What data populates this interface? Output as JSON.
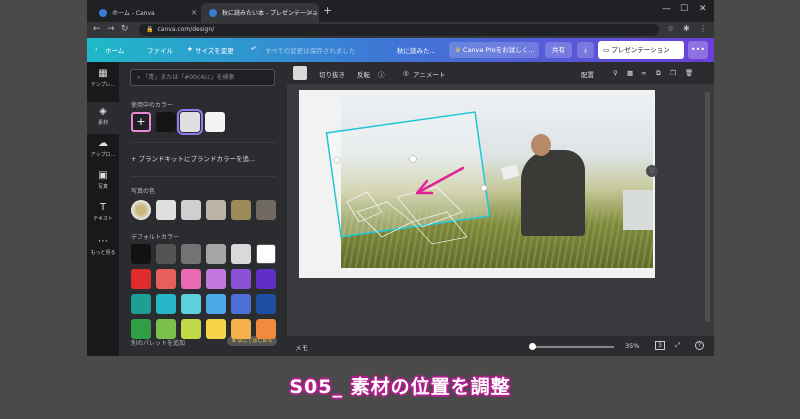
{
  "browser": {
    "tabs": [
      {
        "title": "ホーム - Canva"
      },
      {
        "title": "秋に読みたい本 - プレゼンテーショ"
      }
    ],
    "new_tab": "+",
    "url": "canva.com/design/"
  },
  "header": {
    "home": "ホーム",
    "file": "ファイル",
    "resize": "サイズを変更",
    "saved_status": "すべての変更は保存されました",
    "doc_title": "秋に読みた...",
    "try_pro": "Canva Proをお試しく...",
    "share": "共有",
    "present": "プレゼンテーション",
    "more": "•••"
  },
  "rail": {
    "items": [
      {
        "label": "テンプレ...",
        "icon": "template-icon"
      },
      {
        "label": "素材",
        "icon": "elements-icon"
      },
      {
        "label": "アップロ...",
        "icon": "upload-icon"
      },
      {
        "label": "写真",
        "icon": "photo-icon"
      },
      {
        "label": "テキスト",
        "icon": "text-icon"
      },
      {
        "label": "もっと見る",
        "icon": "more-icon"
      }
    ]
  },
  "panel": {
    "search_placeholder": "「青」または「#00c4cc」を検索",
    "in_use_title": "使用中のカラー",
    "in_use_colors": [
      "#151515",
      "#e0e0e0",
      "#f4f4f4"
    ],
    "add_brand": "+ ブランドキットにブランドカラーを追...",
    "photo_colors_title": "写真の色",
    "photo_colors": [
      "#e0e0e0",
      "#cfcfcf",
      "#b9b4a5",
      "#9d8a5a",
      "#6f6962"
    ],
    "default_colors_title": "デフォルトカラー",
    "default_colors": [
      [
        "#121212",
        "#545454",
        "#737373",
        "#a6a6a6",
        "#d9d9d9",
        "#ffffff"
      ],
      [
        "#e02b2b",
        "#e85d5d",
        "#e86bb2",
        "#c477e0",
        "#8c52d6",
        "#5f2fc8"
      ],
      [
        "#1f9e94",
        "#25b7c7",
        "#5dd0de",
        "#4aa9e8",
        "#4e70d6",
        "#1c4ea3"
      ],
      [
        "#2f9e44",
        "#7ac04a",
        "#c2d94a",
        "#f5d44a",
        "#f5b24a",
        "#f08a3c"
      ]
    ],
    "add_palette": "別のパレットを追加",
    "pro_badge": "♛ 試してはじめる"
  },
  "toolbar": {
    "crop": "切り抜き",
    "flip": "反転",
    "info": "ⓘ",
    "animate": "アニメート",
    "arrange": "配置"
  },
  "bottombar": {
    "notes": "メモ",
    "zoom": "35%",
    "page_num": "3",
    "help": "?"
  },
  "caption": "S05_ 素材の位置を調整",
  "colors": {
    "selection": "#1fc7d4",
    "arrow": "#e0249a",
    "caption_outline": "#b01f8c"
  }
}
